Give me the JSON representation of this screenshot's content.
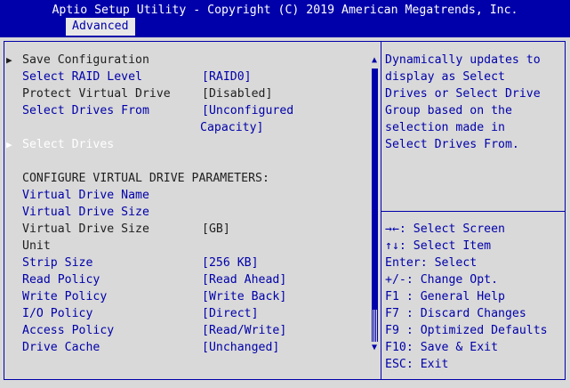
{
  "header": {
    "title": "Aptio Setup Utility - Copyright (C) 2019 American Megatrends, Inc.",
    "tab": "Advanced"
  },
  "menu": {
    "save_configuration": "Save Configuration",
    "select_raid_level": {
      "label": "Select RAID Level",
      "value": "[RAID0]"
    },
    "protect_virtual_drive": {
      "label": "Protect Virtual Drive",
      "value": "[Disabled]"
    },
    "select_drives_from": {
      "label": "Select Drives From",
      "value_line1": "[Unconfigured",
      "value_line2": "Capacity]"
    },
    "select_drives": "Select Drives",
    "section_heading": "CONFIGURE VIRTUAL DRIVE PARAMETERS:",
    "virtual_drive_name": "Virtual Drive Name",
    "virtual_drive_size": "Virtual Drive Size",
    "virtual_drive_size_unit": {
      "label_line1": "Virtual Drive Size",
      "label_line2": "Unit",
      "value": "[GB]"
    },
    "strip_size": {
      "label": "Strip Size",
      "value": "[256 KB]"
    },
    "read_policy": {
      "label": "Read Policy",
      "value": "[Read Ahead]"
    },
    "write_policy": {
      "label": "Write Policy",
      "value": "[Write Back]"
    },
    "io_policy": {
      "label": "I/O Policy",
      "value": "[Direct]"
    },
    "access_policy": {
      "label": "Access Policy",
      "value": "[Read/Write]"
    },
    "drive_cache": {
      "label": "Drive Cache",
      "value": "[Unchanged]"
    }
  },
  "help": {
    "lines": [
      "Dynamically updates to",
      "display as Select",
      "Drives or Select Drive",
      "Group based on the",
      "selection made in",
      "Select Drives From."
    ]
  },
  "keys": [
    "→←: Select Screen",
    "↑↓: Select Item",
    "Enter: Select",
    "+/-: Change Opt.",
    "F1 : General Help",
    "F7 : Discard Changes",
    "F9 : Optimized Defaults",
    "F10: Save & Exit",
    "ESC: Exit"
  ],
  "icons": {
    "submenu_arrow": "triangle-right-icon",
    "scroll_up": "triangle-up-icon",
    "scroll_down": "triangle-down-icon"
  },
  "colors": {
    "background": "#d9d9d9",
    "accent": "#0000aa",
    "highlight_text": "#ffffff"
  }
}
